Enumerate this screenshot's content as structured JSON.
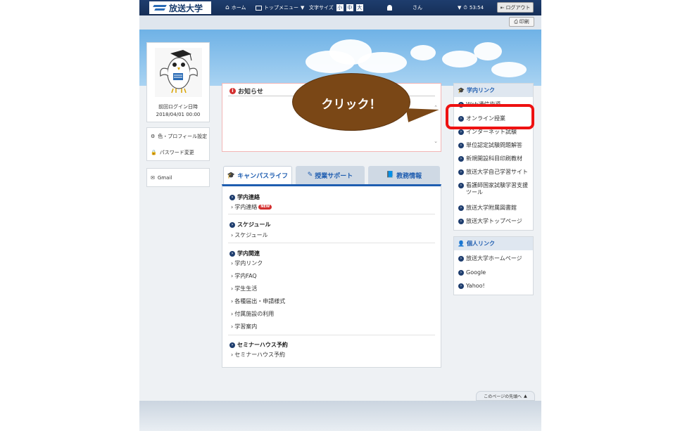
{
  "header": {
    "logo": "放送大学",
    "home": "ホーム",
    "top_menu": "トップメニュー",
    "font_size_label": "文字サイズ",
    "font_sizes": [
      "小",
      "中",
      "大"
    ],
    "user_suffix": "さん",
    "timer": "53:54",
    "logout": "ログアウト"
  },
  "toolbar": {
    "print": "印刷"
  },
  "profile": {
    "last_login_label": "前回ログイン日時",
    "last_login_value": "2018/04/01 00:00"
  },
  "side_menu": {
    "color_profile": "色・プロフィール設定",
    "password": "パスワード変更",
    "gmail": "Gmail"
  },
  "notice": {
    "title": "お知らせ"
  },
  "callout": {
    "text": "クリック！",
    "color": "#7a4716"
  },
  "tabs": [
    {
      "label": "キャンパスライフ",
      "icon": "graduation-cap-icon"
    },
    {
      "label": "授業サポート",
      "icon": "pencil-icon"
    },
    {
      "label": "教務情報",
      "icon": "book-icon"
    }
  ],
  "campus": {
    "sections": [
      {
        "title": "学内連絡",
        "links": [
          "学内連絡"
        ],
        "badge": "NEW"
      },
      {
        "title": "スケジュール",
        "links": [
          "スケジュール"
        ]
      },
      {
        "title": "学内関連",
        "links": [
          "学内リンク",
          "学内FAQ",
          "学生生活",
          "各種届出・申請様式",
          "付属施設の利用",
          "学習案内"
        ]
      },
      {
        "title": "セミナーハウス予約",
        "links": [
          "セミナーハウス予約"
        ]
      }
    ]
  },
  "campus_links_panel": {
    "title": "学内リンク",
    "links": [
      "Web通信指導",
      "オンライン授業",
      "インターネット試験",
      "単位認定試験問題解答",
      "新規開設科目印刷教材",
      "放送大学自己学習サイト",
      "看護師国家試験学習支援ツール",
      "放送大学附属図書館",
      "放送大学トップページ"
    ]
  },
  "personal_links_panel": {
    "title": "個人リンク",
    "links": [
      "放送大学ホームページ",
      "Google",
      "Yahoo!"
    ]
  },
  "page_top": "このページの先頭へ",
  "colors": {
    "accent": "#1e5db0",
    "header": "#1e3d6e",
    "highlight": "#ee1111"
  }
}
